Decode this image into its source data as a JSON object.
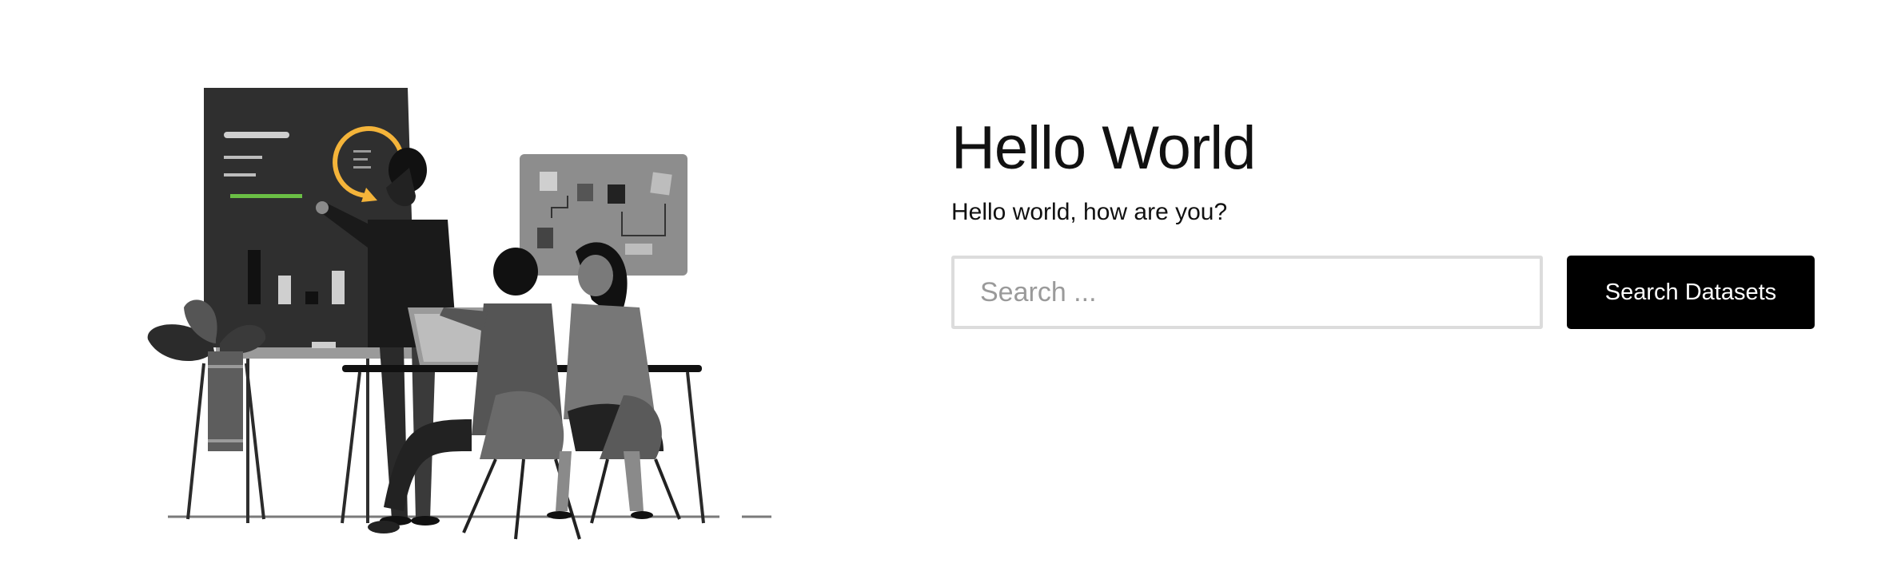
{
  "hero": {
    "title": "Hello World",
    "subtitle": "Hello world, how are you?"
  },
  "search": {
    "placeholder": "Search ...",
    "value": "",
    "button_label": "Search Datasets"
  },
  "illustration": {
    "icon": "team-meeting-illustration"
  },
  "colors": {
    "background": "#ffffff",
    "text": "#111111",
    "button_bg": "#000000",
    "button_text": "#ffffff",
    "input_border": "#dcdcdc",
    "accent_yellow": "#f4b43a",
    "accent_green": "#6abf45"
  }
}
